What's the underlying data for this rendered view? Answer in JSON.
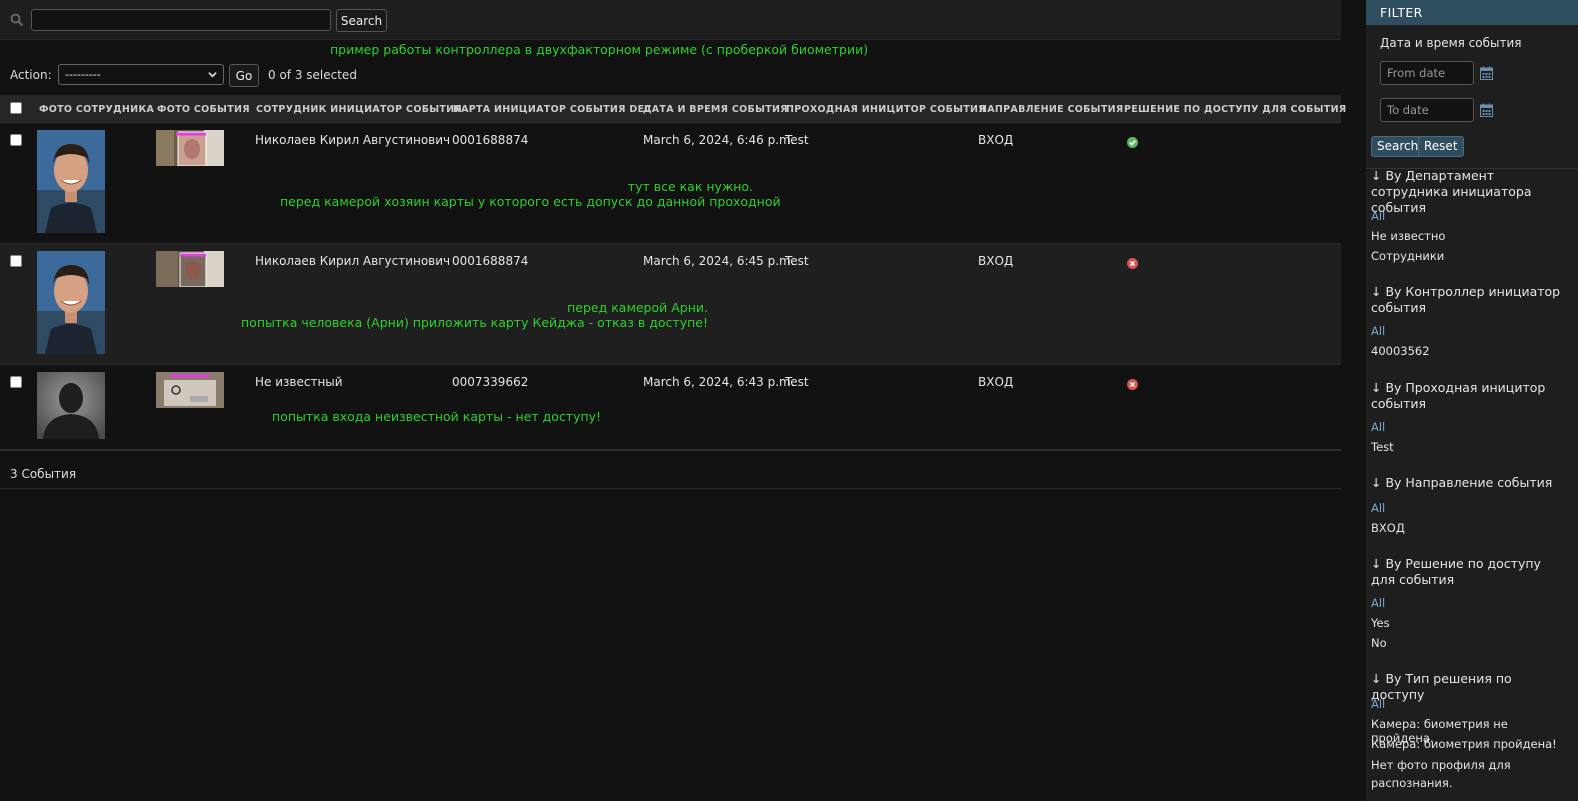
{
  "search": {
    "value": "",
    "button_label": "Search"
  },
  "annotation_top": "пример работы контроллера в двухфакторном режиме (с проберкой биометрии)",
  "actions": {
    "label": "Action:",
    "selected_option": "---------",
    "go_label": "Go",
    "selected_count": "0 of 3 selected"
  },
  "table": {
    "headers": [
      "ФОТО СОТРУДНИКА",
      "ФОТО СОБЫТИЯ",
      "СОТРУДНИК ИНИЦИАТОР СОБЫТИЯ",
      "КАРТА ИНИЦИАТОР СОБЫТИЯ DEC",
      "ДАТА И ВРЕМЯ СОБЫТИЯ",
      "ПРОХОДНАЯ ИНИЦИТОР СОБЫТИЯ",
      "НАПРАВЛЕНИЕ СОБЫТИЯ",
      "РЕШЕНИЕ ПО ДОСТУПУ ДЛЯ СОБЫТИЯ"
    ],
    "rows": [
      {
        "employee": "Николаев Кирил Августинович",
        "card": "0001688874",
        "datetime": "March 6, 2024, 6:46 p.m.",
        "checkpoint": "Test",
        "direction": "ВХОД",
        "decision": "granted",
        "note_line1": "тут все как нужно.",
        "note_line2": "перед камерой хозяин карты у которого есть допуск до данной проходной"
      },
      {
        "employee": "Николаев Кирил Августинович",
        "card": "0001688874",
        "datetime": "March 6, 2024, 6:45 p.m.",
        "checkpoint": "Test",
        "direction": "ВХОД",
        "decision": "denied",
        "note_line1": "перед камерой Арни.",
        "note_line2": "попытка человека (Арни) приложить карту Кейджа - отказ в доступе!"
      },
      {
        "employee": "Не известный",
        "card": "0007339662",
        "datetime": "March 6, 2024, 6:43 p.m.",
        "checkpoint": "Test",
        "direction": "ВХОД",
        "decision": "denied",
        "note_line1": "попытка входа неизвестной карты - нет доступу!"
      }
    ],
    "footer": "3 События"
  },
  "filter": {
    "title": "FILTER",
    "date_label": "Дата и время события",
    "from_placeholder": "From date",
    "to_placeholder": "To date",
    "search_label": "Search",
    "reset_label": "Reset",
    "groups": [
      {
        "title": "↓ By Департамент сотрудника инициатора события",
        "items": [
          "All",
          "Не известно",
          "Сотрудники"
        ]
      },
      {
        "title": "↓ By Контроллер инициатор события",
        "items": [
          "All",
          "40003562"
        ]
      },
      {
        "title": "↓ By Проходная иницитор события",
        "items": [
          "All",
          "Test"
        ]
      },
      {
        "title": "↓ By Направление события",
        "items": [
          "All",
          "ВХОД"
        ]
      },
      {
        "title": "↓ By Решение по доступу для события",
        "items": [
          "All",
          "Yes",
          "No"
        ]
      },
      {
        "title": "↓ By Тип решения по доступу",
        "items": [
          "All",
          "Камера: биометрия не пройдена.",
          "Камера: биометрия пройдена!",
          "Нет фото профиля для распознания."
        ]
      }
    ]
  },
  "colors": {
    "annotation": "#2ed12e",
    "accent": "#2e4e60",
    "link": "#79a6d2",
    "granted": "#5cb85c",
    "denied": "#d9534f"
  }
}
